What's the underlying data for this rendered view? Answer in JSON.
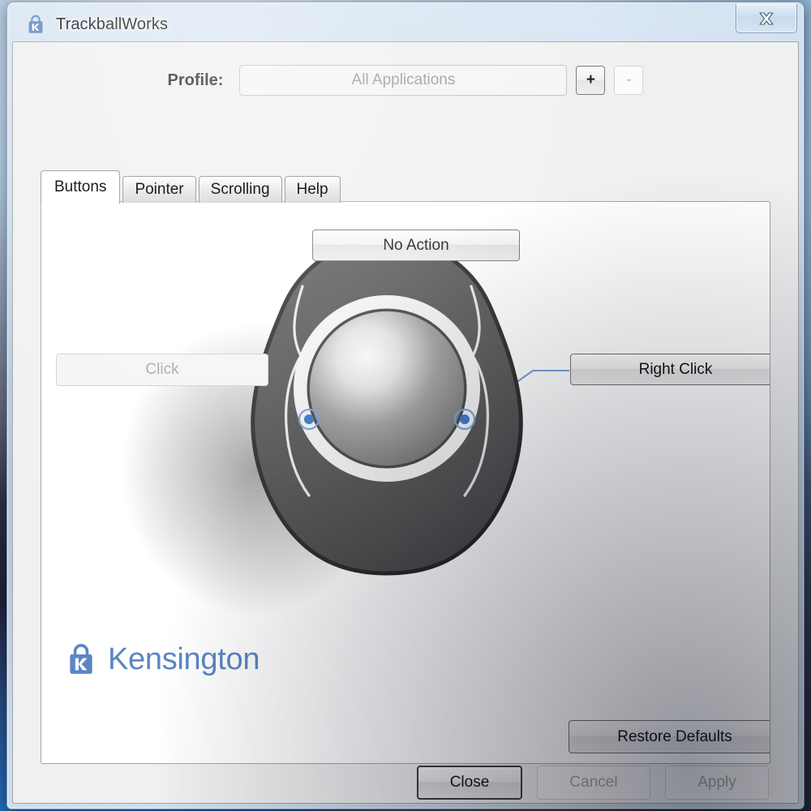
{
  "window": {
    "title": "TrackballWorks",
    "icon": "kensington-padlock-icon",
    "close_glyph": "✕",
    "close_label": "Close window"
  },
  "profile": {
    "label": "Profile:",
    "value": "All Applications",
    "placeholder": "All Applications",
    "add_label": "+",
    "remove_label": "-"
  },
  "tabs": [
    {
      "label": "Buttons",
      "active": true
    },
    {
      "label": "Pointer",
      "active": false
    },
    {
      "label": "Scrolling",
      "active": false
    },
    {
      "label": "Help",
      "active": false
    }
  ],
  "buttons_tab": {
    "assignments": [
      {
        "name": "no-action",
        "label": "No Action",
        "enabled": true
      },
      {
        "name": "click",
        "label": "Click",
        "enabled": false
      },
      {
        "name": "right-click",
        "label": "Right Click",
        "enabled": true
      }
    ],
    "restore_defaults_label": "Restore Defaults",
    "brand_name": "Kensington",
    "brand_trademark": "®"
  },
  "footer": {
    "close_label": "Close",
    "cancel_label": "Cancel",
    "apply_label": "Apply",
    "close_enabled": true,
    "cancel_enabled": false,
    "apply_enabled": false
  },
  "colors": {
    "accent_blue": "#5b86c4",
    "callout_line": "#6f9ad4",
    "callout_dot": "#2f6fc0",
    "device_body": "#4d4d4d",
    "device_outline": "#232323",
    "panel_bg": "#ffffff",
    "client_bg": "#f0f0f0",
    "disabled_text": "#a6a29b"
  }
}
